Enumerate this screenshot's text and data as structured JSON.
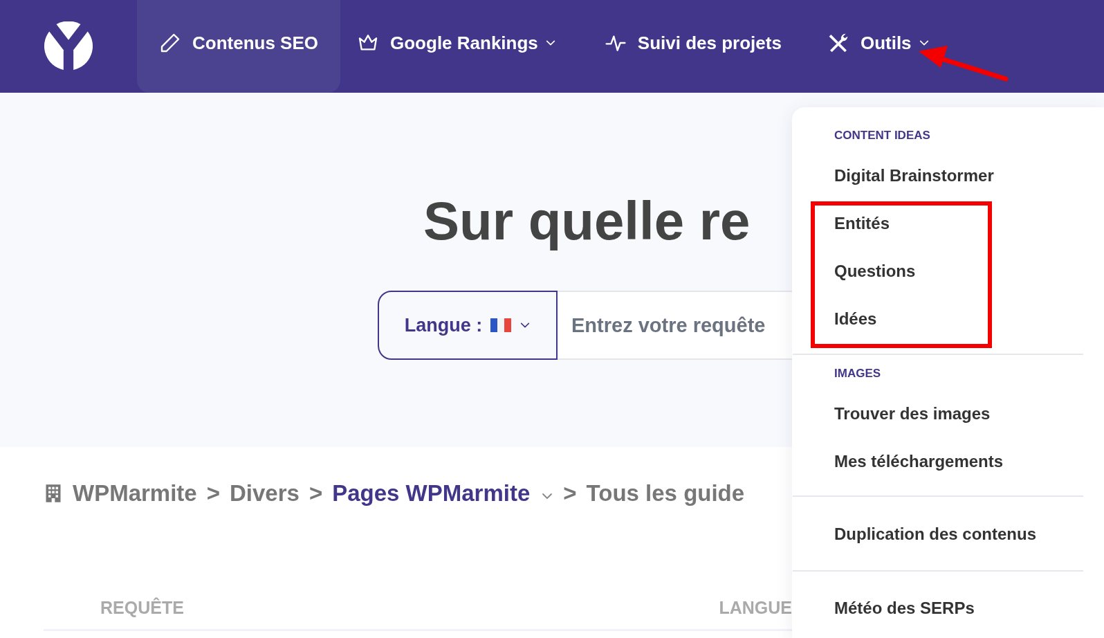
{
  "nav": {
    "items": [
      {
        "label": "Contenus SEO",
        "kind": "pencil",
        "selected": true,
        "dropdown": false
      },
      {
        "label": "Google Rankings",
        "kind": "crown",
        "selected": false,
        "dropdown": true
      },
      {
        "label": "Suivi des projets",
        "kind": "pulse",
        "selected": false,
        "dropdown": false
      },
      {
        "label": "Outils",
        "kind": "tools",
        "selected": false,
        "dropdown": true
      }
    ]
  },
  "hero": {
    "title": "Sur quelle re",
    "language_selector": {
      "label": "Langue :"
    },
    "search": {
      "placeholder": "Entrez votre requête"
    }
  },
  "breadcrumb": [
    {
      "label": "WPMarmite",
      "kind": "org"
    },
    {
      "separator": ">",
      "label": "Divers"
    },
    {
      "separator": ">",
      "label": "Pages WPMarmite",
      "current": true,
      "dropdown": true
    },
    {
      "separator": ">",
      "label": "Tous les guide"
    }
  ],
  "table": {
    "columns": [
      "REQUÊTE",
      "LANGUE"
    ]
  },
  "menu": {
    "sections": [
      {
        "heading": "CONTENT IDEAS",
        "items": [
          "Digital Brainstormer",
          "Entités",
          "Questions",
          "Idées"
        ]
      },
      {
        "heading": "IMAGES",
        "items": [
          "Trouver des images",
          "Mes téléchargements"
        ]
      },
      {
        "items": [
          "Duplication des contenus"
        ]
      },
      {
        "items": [
          "Météo des SERPs"
        ]
      }
    ]
  }
}
